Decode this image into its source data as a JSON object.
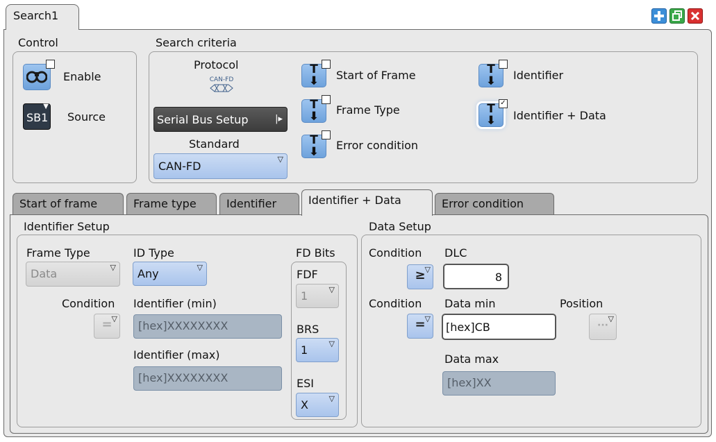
{
  "window": {
    "tab_label": "Search1"
  },
  "toolbar": {
    "add_icon": "plus-icon",
    "copy_icon": "copy-icon",
    "close_icon": "close-icon",
    "colors": {
      "add": "#3d8fd8",
      "copy": "#3aa84a",
      "close": "#d93030"
    }
  },
  "control": {
    "title": "Control",
    "enable_label": "Enable",
    "source_label": "Source",
    "source_icon_text": "SB1"
  },
  "criteria": {
    "title": "Search criteria",
    "protocol_label": "Protocol",
    "protocol_icon_text": "CAN-FD",
    "serial_bus_setup_label": "Serial Bus Setup",
    "standard_label": "Standard",
    "standard_value": "CAN-FD",
    "items": [
      {
        "label": "Start of Frame",
        "checked": false
      },
      {
        "label": "Frame Type",
        "checked": false
      },
      {
        "label": "Error condition",
        "checked": false
      },
      {
        "label": "Identifier",
        "checked": false
      },
      {
        "label": "Identifier + Data",
        "checked": true
      }
    ]
  },
  "tabs": [
    {
      "label": "Start of frame"
    },
    {
      "label": "Frame type"
    },
    {
      "label": "Identifier"
    },
    {
      "label": "Identifier + Data",
      "active": true
    },
    {
      "label": "Error condition"
    }
  ],
  "identifier_setup": {
    "title": "Identifier Setup",
    "frame_type_label": "Frame Type",
    "frame_type_value": "Data",
    "id_type_label": "ID Type",
    "id_type_value": "Any",
    "condition_label": "Condition",
    "condition_symbol": "=",
    "identifier_min_label": "Identifier (min)",
    "identifier_min_value": "[hex]XXXXXXXX",
    "identifier_max_label": "Identifier (max)",
    "identifier_max_value": "[hex]XXXXXXXX",
    "fd_bits_label": "FD Bits",
    "fdf_label": "FDF",
    "fdf_value": "1",
    "brs_label": "BRS",
    "brs_value": "1",
    "esi_label": "ESI",
    "esi_value": "X"
  },
  "data_setup": {
    "title": "Data Setup",
    "condition1_label": "Condition",
    "condition1_symbol": "≥",
    "dlc_label": "DLC",
    "dlc_value": "8",
    "condition2_label": "Condition",
    "condition2_symbol": "=",
    "data_min_label": "Data min",
    "data_min_value": "[hex]CB",
    "position_label": "Position",
    "position_symbol": "···",
    "data_max_label": "Data max",
    "data_max_value": "[hex]XX"
  }
}
